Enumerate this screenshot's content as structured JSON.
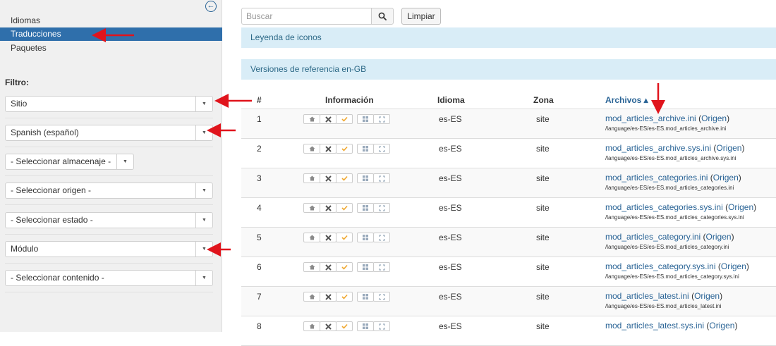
{
  "sidebar": {
    "nav": [
      {
        "label": "Idiomas",
        "active": false
      },
      {
        "label": "Traducciones",
        "active": true
      },
      {
        "label": "Paquetes",
        "active": false
      }
    ],
    "filter_label": "Filtro:",
    "filters": [
      {
        "value": "Sitio"
      },
      {
        "value": "Spanish (español)"
      },
      {
        "value": "- Seleccionar almacenaje -"
      },
      {
        "value": "- Seleccionar origen -"
      },
      {
        "value": "- Seleccionar estado -"
      },
      {
        "value": "Módulo"
      },
      {
        "value": "- Seleccionar contenido -"
      }
    ]
  },
  "toolbar": {
    "search_placeholder": "Buscar",
    "clear_label": "Limpiar"
  },
  "legend_bar": "Leyenda de iconos",
  "reference_bar": "Versiones de referencia en-GB",
  "table": {
    "headers": {
      "num": "#",
      "info": "Información",
      "lang": "Idioma",
      "zone": "Zona",
      "files": "Archivos ▴"
    },
    "rows": [
      {
        "num": "1",
        "lang": "es-ES",
        "zone": "site",
        "file": "mod_articles_archive.ini",
        "origin": "Origen",
        "path": "/language/es-ES/es-ES.mod_articles_archive.ini"
      },
      {
        "num": "2",
        "lang": "es-ES",
        "zone": "site",
        "file": "mod_articles_archive.sys.ini",
        "origin": "Origen",
        "path": "/language/es-ES/es-ES.mod_articles_archive.sys.ini"
      },
      {
        "num": "3",
        "lang": "es-ES",
        "zone": "site",
        "file": "mod_articles_categories.ini",
        "origin": "Origen",
        "path": "/language/es-ES/es-ES.mod_articles_categories.ini"
      },
      {
        "num": "4",
        "lang": "es-ES",
        "zone": "site",
        "file": "mod_articles_categories.sys.ini",
        "origin": "Origen",
        "path": "/language/es-ES/es-ES.mod_articles_categories.sys.ini"
      },
      {
        "num": "5",
        "lang": "es-ES",
        "zone": "site",
        "file": "mod_articles_category.ini",
        "origin": "Origen",
        "path": "/language/es-ES/es-ES.mod_articles_category.ini"
      },
      {
        "num": "6",
        "lang": "es-ES",
        "zone": "site",
        "file": "mod_articles_category.sys.ini",
        "origin": "Origen",
        "path": "/language/es-ES/es-ES.mod_articles_category.sys.ini"
      },
      {
        "num": "7",
        "lang": "es-ES",
        "zone": "site",
        "file": "mod_articles_latest.ini",
        "origin": "Origen",
        "path": "/language/es-ES/es-ES.mod_articles_latest.ini"
      },
      {
        "num": "8",
        "lang": "es-ES",
        "zone": "site",
        "file": "mod_articles_latest.sys.ini",
        "origin": "Origen",
        "path": ""
      }
    ],
    "row_icons": [
      "home-icon",
      "joomla-icon",
      "check-icon",
      "grid-icon",
      "expand-icon"
    ]
  },
  "colors": {
    "active_nav": "#2f6fab",
    "info_bar_bg": "#d9edf7",
    "info_bar_text": "#2d6987",
    "link": "#2a6496",
    "annotation_arrow": "#e0141c",
    "check_icon": "#f0a830"
  }
}
